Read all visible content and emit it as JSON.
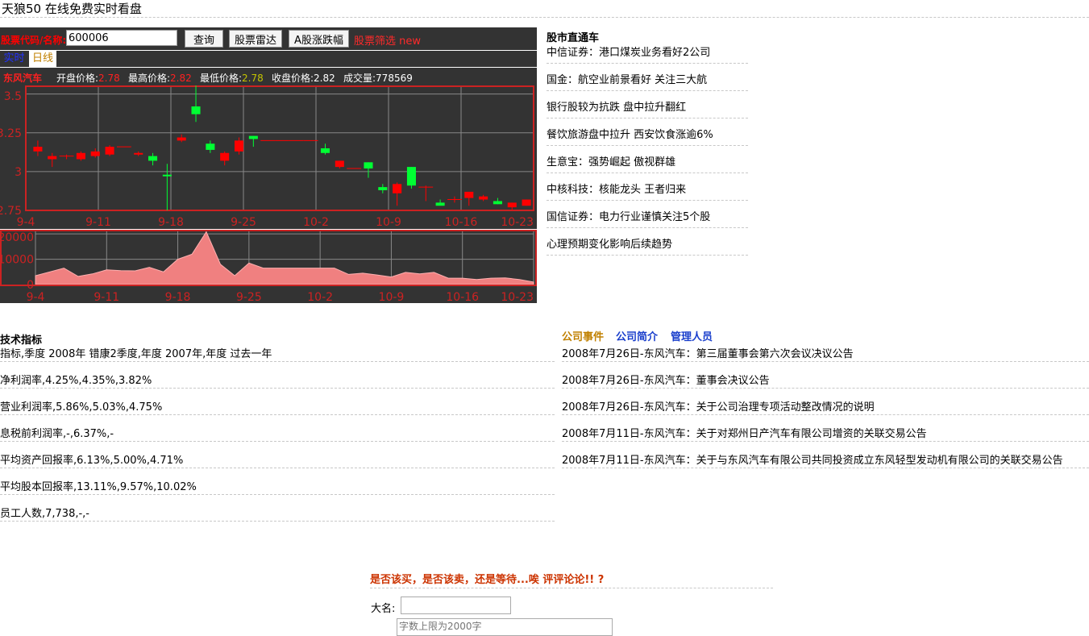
{
  "site": {
    "title": "天狼50 在线免费实时看盘"
  },
  "toolbar": {
    "code_label": "股票代码/名称:",
    "code_value": "600006",
    "query_button": "查询",
    "radar_button": "股票雷达",
    "updown_button": "A股涨跌幅",
    "filter_link": "股票筛选 new"
  },
  "mode_tabs": {
    "realtime": "实时",
    "daily": "日线"
  },
  "quote": {
    "name": "东风汽车",
    "open_label": "开盘价格:",
    "open": "2.78",
    "high_label": "最高价格:",
    "high": "2.82",
    "low_label": "最低价格:",
    "low": "2.78",
    "close_label": "收盘价格:",
    "close": "2.82",
    "volume_label": "成交量:",
    "volume": "778569"
  },
  "colors": {
    "up": "#ff0000",
    "down": "#00ff33",
    "panel": "#333333",
    "border": "#cc2222",
    "grid": "#888888",
    "axis_text": "#cc2222",
    "volume_fill": "#f08080"
  },
  "chart_data": [
    {
      "type": "candlestick",
      "x_tick_labels": [
        "9-4",
        "9-11",
        "9-18",
        "9-25",
        "10-2",
        "10-9",
        "10-16",
        "10-23"
      ],
      "y_tick_labels": [
        "3.5",
        "3.25",
        "3",
        "2.75"
      ],
      "ylim": [
        2.75,
        3.55
      ],
      "grid": true,
      "candles": [
        {
          "o": 3.13,
          "h": 3.2,
          "l": 3.1,
          "c": 3.16
        },
        {
          "o": 3.08,
          "h": 3.12,
          "l": 3.03,
          "c": 3.1
        },
        {
          "o": 3.1,
          "h": 3.11,
          "l": 3.08,
          "c": 3.1
        },
        {
          "o": 3.08,
          "h": 3.13,
          "l": 3.07,
          "c": 3.12
        },
        {
          "o": 3.1,
          "h": 3.15,
          "l": 3.09,
          "c": 3.13
        },
        {
          "o": 3.11,
          "h": 3.17,
          "l": 3.1,
          "c": 3.16
        },
        {
          "o": 3.16,
          "h": 3.16,
          "l": 3.16,
          "c": 3.16
        },
        {
          "o": 3.11,
          "h": 3.13,
          "l": 3.1,
          "c": 3.12
        },
        {
          "o": 3.1,
          "h": 3.12,
          "l": 3.04,
          "c": 3.07
        },
        {
          "o": 2.98,
          "h": 3.05,
          "l": 2.75,
          "c": 2.97
        },
        {
          "o": 3.2,
          "h": 3.24,
          "l": 3.19,
          "c": 3.22
        },
        {
          "o": 3.42,
          "h": 3.56,
          "l": 3.32,
          "c": 3.37
        },
        {
          "o": 3.18,
          "h": 3.2,
          "l": 3.12,
          "c": 3.14
        },
        {
          "o": 3.07,
          "h": 3.13,
          "l": 3.04,
          "c": 3.12
        },
        {
          "o": 3.13,
          "h": 3.22,
          "l": 3.11,
          "c": 3.2
        },
        {
          "o": 3.23,
          "h": 3.23,
          "l": 3.16,
          "c": 3.21
        },
        {
          "o": 3.2,
          "h": 3.2,
          "l": 3.2,
          "c": 3.2
        },
        {
          "o": 3.2,
          "h": 3.2,
          "l": 3.2,
          "c": 3.2
        },
        {
          "o": 3.2,
          "h": 3.2,
          "l": 3.2,
          "c": 3.2
        },
        {
          "o": 3.2,
          "h": 3.2,
          "l": 3.2,
          "c": 3.2
        },
        {
          "o": 3.15,
          "h": 3.18,
          "l": 3.11,
          "c": 3.12
        },
        {
          "o": 3.03,
          "h": 3.07,
          "l": 3.02,
          "c": 3.07
        },
        {
          "o": 3.02,
          "h": 3.02,
          "l": 3.02,
          "c": 3.02
        },
        {
          "o": 3.06,
          "h": 3.06,
          "l": 2.96,
          "c": 3.02
        },
        {
          "o": 2.9,
          "h": 2.92,
          "l": 2.86,
          "c": 2.88
        },
        {
          "o": 2.86,
          "h": 2.93,
          "l": 2.78,
          "c": 2.92
        },
        {
          "o": 3.03,
          "h": 3.03,
          "l": 2.89,
          "c": 2.91
        },
        {
          "o": 2.9,
          "h": 2.91,
          "l": 2.81,
          "c": 2.9
        },
        {
          "o": 2.8,
          "h": 2.82,
          "l": 2.79,
          "c": 2.78
        },
        {
          "o": 2.82,
          "h": 2.84,
          "l": 2.8,
          "c": 2.82
        },
        {
          "o": 2.83,
          "h": 2.86,
          "l": 2.78,
          "c": 2.87
        },
        {
          "o": 2.82,
          "h": 2.85,
          "l": 2.81,
          "c": 2.84
        },
        {
          "o": 2.81,
          "h": 2.83,
          "l": 2.79,
          "c": 2.79
        },
        {
          "o": 2.77,
          "h": 2.8,
          "l": 2.75,
          "c": 2.8
        },
        {
          "o": 2.78,
          "h": 2.82,
          "l": 2.78,
          "c": 2.82
        }
      ]
    },
    {
      "type": "area",
      "x_tick_labels": [
        "9-4",
        "9-11",
        "9-18",
        "9-25",
        "10-2",
        "10-9",
        "10-16",
        "10-23"
      ],
      "y_tick_labels": [
        "20000",
        "10000",
        "0"
      ],
      "ylim": [
        0,
        21000
      ],
      "grid": true,
      "values": [
        3500,
        5000,
        6500,
        3200,
        4200,
        5800,
        5500,
        5400,
        6800,
        5000,
        10000,
        12000,
        20800,
        8000,
        3500,
        8500,
        6500,
        6500,
        6500,
        6500,
        6500,
        6500,
        4000,
        4500,
        3800,
        3000,
        4800,
        4200,
        4800,
        2500,
        2500,
        2000,
        2500,
        2600,
        2000,
        1000
      ]
    }
  ],
  "news": {
    "title": "股市直通车",
    "items": [
      "中信证券：港口煤炭业务看好2公司",
      "国金：航空业前景看好 关注三大航",
      "银行股较为抗跌 盘中拉升翻红",
      "餐饮旅游盘中拉升 西安饮食涨逾6%",
      "生意宝：强势崛起 傲视群雄",
      "中核科技：核能龙头 王者归来",
      "国信证券：电力行业谨慎关注5个股",
      "心理预期变化影响后续趋势"
    ]
  },
  "tech": {
    "title": "技术指标",
    "rows": [
      "指标,季度 2008年 错康2季度,年度 2007年,年度 过去一年",
      "净利润率,4.25%,4.35%,3.82%",
      "营业利润率,5.86%,5.03%,4.75%",
      "息税前利润率,-,6.37%,-",
      "平均资产回报率,6.13%,5.00%,4.71%",
      "平均股本回报率,13.11%,9.57%,10.02%",
      "员工人数,7,738,-,-"
    ]
  },
  "company": {
    "tabs": [
      "公司事件",
      "公司简介",
      "管理人员"
    ],
    "events": [
      "2008年7月26日-东风汽车：第三届董事会第六次会议决议公告",
      "2008年7月26日-东风汽车：董事会决议公告",
      "2008年7月26日-东风汽车：关于公司治理专项活动整改情况的说明",
      "2008年7月11日-东风汽车：关于对郑州日产汽车有限公司增资的关联交易公告",
      "2008年7月11日-东风汽车：关于与东风汽车有限公司共同投资成立东风轻型发动机有限公司的关联交易公告"
    ]
  },
  "comment": {
    "title": "是否该买，是否该卖，还是等待...唉 评评论论!! ?",
    "name_label": "大名:",
    "name_value": "",
    "content_placeholder": "字数上限为2000字"
  }
}
